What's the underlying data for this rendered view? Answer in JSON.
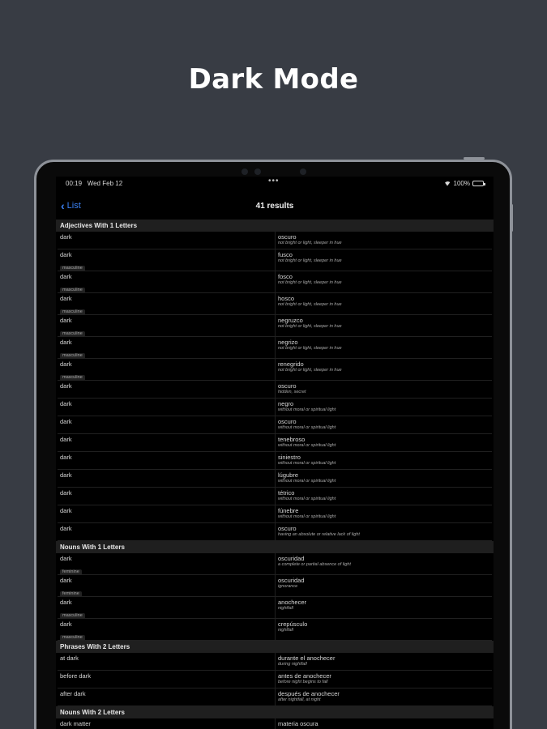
{
  "headline": "Dark Mode",
  "status_bar": {
    "time": "00:19",
    "date": "Wed Feb 12",
    "battery": "100%"
  },
  "nav": {
    "back_label": "List",
    "title": "41 results"
  },
  "sections": [
    {
      "title": "Adjectives With 1 Letters",
      "rows": [
        {
          "en": "dark",
          "tag": "",
          "es": "oscuro",
          "gloss": "not bright or light, sleeper in hue"
        },
        {
          "en": "dark",
          "tag": "masculine",
          "es": "fusco",
          "gloss": "not bright or light, sleeper in hue"
        },
        {
          "en": "dark",
          "tag": "masculine",
          "es": "fosco",
          "gloss": "not bright or light, sleeper in hue"
        },
        {
          "en": "dark",
          "tag": "masculine",
          "es": "hosco",
          "gloss": "not bright or light, sleeper in hue"
        },
        {
          "en": "dark",
          "tag": "masculine",
          "es": "negruzco",
          "gloss": "not bright or light, sleeper in hue"
        },
        {
          "en": "dark",
          "tag": "masculine",
          "es": "negrizo",
          "gloss": "not bright or light, sleeper in hue"
        },
        {
          "en": "dark",
          "tag": "masculine",
          "es": "renegrido",
          "gloss": "not bright or light, sleeper in hue"
        },
        {
          "en": "dark",
          "tag": "",
          "es": "oscuro",
          "gloss": "hidden, secret"
        },
        {
          "en": "dark",
          "tag": "",
          "es": "negro",
          "gloss": "without moral or spiritual light"
        },
        {
          "en": "dark",
          "tag": "",
          "es": "oscuro",
          "gloss": "without moral or spiritual light"
        },
        {
          "en": "dark",
          "tag": "",
          "es": "tenebroso",
          "gloss": "without moral or spiritual light"
        },
        {
          "en": "dark",
          "tag": "",
          "es": "siniestro",
          "gloss": "without moral or spiritual light"
        },
        {
          "en": "dark",
          "tag": "",
          "es": "lúgubre",
          "gloss": "without moral or spiritual light"
        },
        {
          "en": "dark",
          "tag": "",
          "es": "tétrico",
          "gloss": "without moral or spiritual light"
        },
        {
          "en": "dark",
          "tag": "",
          "es": "fúnebre",
          "gloss": "without moral or spiritual light"
        },
        {
          "en": "dark",
          "tag": "",
          "es": "oscuro",
          "gloss": "having an absolute or relative lack of light"
        }
      ]
    },
    {
      "title": "Nouns With 1 Letters",
      "rows": [
        {
          "en": "dark",
          "tag": "feminine",
          "es": "oscuridad",
          "gloss": "a complete or partial absence of light"
        },
        {
          "en": "dark",
          "tag": "feminine",
          "es": "oscuridad",
          "gloss": "ignorance"
        },
        {
          "en": "dark",
          "tag": "masculine",
          "es": "anochecer",
          "gloss": "nightfall"
        },
        {
          "en": "dark",
          "tag": "masculine",
          "es": "crepúsculo",
          "gloss": "nightfall"
        }
      ]
    },
    {
      "title": "Phrases With 2 Letters",
      "rows": [
        {
          "en": "at dark",
          "tag": "",
          "es": "durante el anochecer",
          "gloss": "during nightfall"
        },
        {
          "en": "before dark",
          "tag": "",
          "es": "antes de anochecer",
          "gloss": "before night begins to fall"
        },
        {
          "en": "after dark",
          "tag": "",
          "es": "después de anochecer",
          "gloss": "after nightfall, at night"
        }
      ]
    },
    {
      "title": "Nouns With 2 Letters",
      "rows": [
        {
          "en": "dark matter",
          "tag": "",
          "es": "materia oscura",
          "gloss": ""
        }
      ]
    }
  ]
}
